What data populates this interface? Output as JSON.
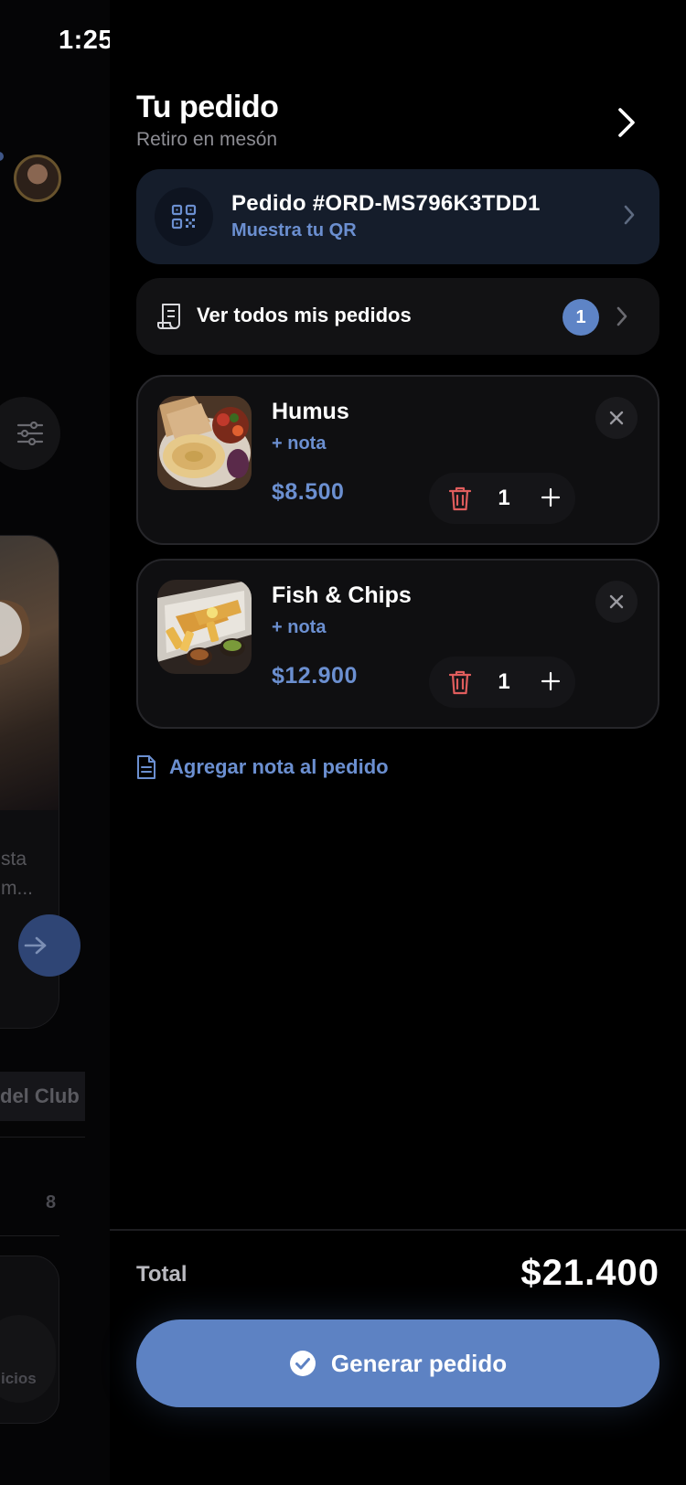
{
  "status_bar": {
    "time": "1:25"
  },
  "background": {
    "card_text_line1": "sta",
    "card_text_line2": "m...",
    "club_label": "del Club",
    "count": "8",
    "services_label": "icios"
  },
  "drawer": {
    "title": "Tu pedido",
    "subtitle": "Retiro en mesón",
    "active_order": {
      "id": "Pedido #ORD-MS796K3TDD1",
      "qr_label": "Muestra tu QR"
    },
    "all_orders": {
      "label": "Ver todos mis pedidos",
      "badge": "1"
    },
    "items": [
      {
        "name": "Humus",
        "note_label": "+ nota",
        "price": "$8.500",
        "quantity": "1"
      },
      {
        "name": "Fish & Chips",
        "note_label": "+ nota",
        "price": "$12.900",
        "quantity": "1"
      }
    ],
    "add_note_label": "Agregar nota al pedido",
    "total_label": "Total",
    "total_value": "$21.400",
    "generate_label": "Generar pedido"
  },
  "colors": {
    "accent": "#5d82c3",
    "link": "#6b8fd0",
    "danger": "#e05d5d",
    "order_card_bg": "#151d2b"
  }
}
